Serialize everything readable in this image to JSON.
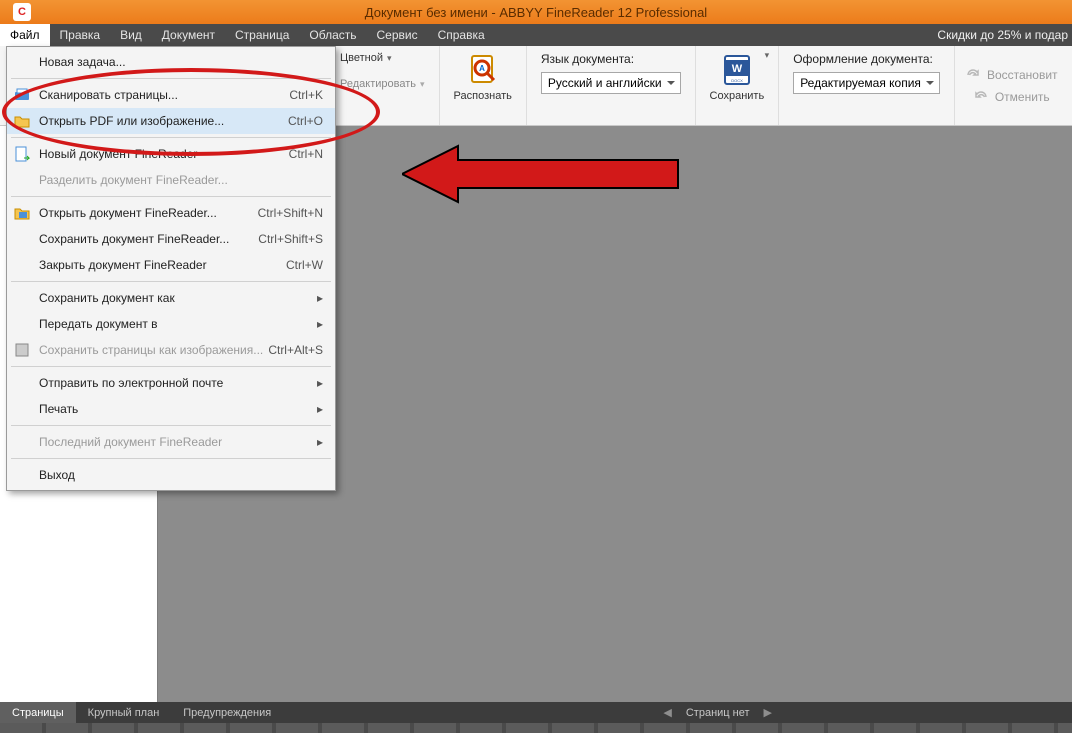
{
  "window": {
    "title": "Документ без имени - ABBYY FineReader 12 Professional"
  },
  "menubar": {
    "items": [
      "Файл",
      "Правка",
      "Вид",
      "Документ",
      "Страница",
      "Область",
      "Сервис",
      "Справка"
    ],
    "promo": "Скидки до 25% и подар"
  },
  "toolbar": {
    "color_label": "Цветной",
    "edit_label": "Редактировать",
    "recognize_label": "Распознать",
    "lang_caption": "Язык документа:",
    "lang_value": "Русский и английски",
    "save_label": "Сохранить",
    "layout_caption": "Оформление документа:",
    "layout_value": "Редактируемая копия",
    "restore_label": "Восстановит",
    "undo_label": "Отменить"
  },
  "file_menu": {
    "items": [
      {
        "label": "Новая задача...",
        "shortcut": "",
        "disabled": false,
        "icon": ""
      },
      {
        "sep": true
      },
      {
        "label": "Сканировать страницы...",
        "shortcut": "Ctrl+K",
        "disabled": false,
        "icon": "scanner"
      },
      {
        "label": "Открыть PDF или изображение...",
        "shortcut": "Ctrl+O",
        "disabled": false,
        "icon": "folder",
        "highlight": true
      },
      {
        "sep": true
      },
      {
        "label": "Новый документ FineReader",
        "shortcut": "Ctrl+N",
        "disabled": false,
        "icon": "newdoc"
      },
      {
        "label": "Разделить документ FineReader...",
        "shortcut": "",
        "disabled": true,
        "icon": ""
      },
      {
        "sep": true
      },
      {
        "label": "Открыть документ FineReader...",
        "shortcut": "Ctrl+Shift+N",
        "disabled": false,
        "icon": "openfr"
      },
      {
        "label": "Сохранить документ FineReader...",
        "shortcut": "Ctrl+Shift+S",
        "disabled": false,
        "icon": ""
      },
      {
        "label": "Закрыть документ FineReader",
        "shortcut": "Ctrl+W",
        "disabled": false,
        "icon": ""
      },
      {
        "sep": true
      },
      {
        "label": "Сохранить документ как",
        "shortcut": "",
        "disabled": false,
        "icon": "",
        "arrow": true
      },
      {
        "label": "Передать документ в",
        "shortcut": "",
        "disabled": false,
        "icon": "",
        "arrow": true
      },
      {
        "label": "Сохранить страницы как изображения...",
        "shortcut": "Ctrl+Alt+S",
        "disabled": true,
        "icon": "saveimg"
      },
      {
        "sep": true
      },
      {
        "label": "Отправить по электронной почте",
        "shortcut": "",
        "disabled": false,
        "icon": "",
        "arrow": true
      },
      {
        "label": "Печать",
        "shortcut": "",
        "disabled": false,
        "icon": "",
        "arrow": true
      },
      {
        "sep": true
      },
      {
        "label": "Последний документ FineReader",
        "shortcut": "",
        "disabled": true,
        "icon": "",
        "arrow": true
      },
      {
        "sep": true
      },
      {
        "label": "Выход",
        "shortcut": "",
        "disabled": false,
        "icon": ""
      }
    ]
  },
  "statusbar": {
    "tabs": [
      "Страницы",
      "Крупный план",
      "Предупреждения"
    ],
    "nav_text": "Страниц нет"
  }
}
